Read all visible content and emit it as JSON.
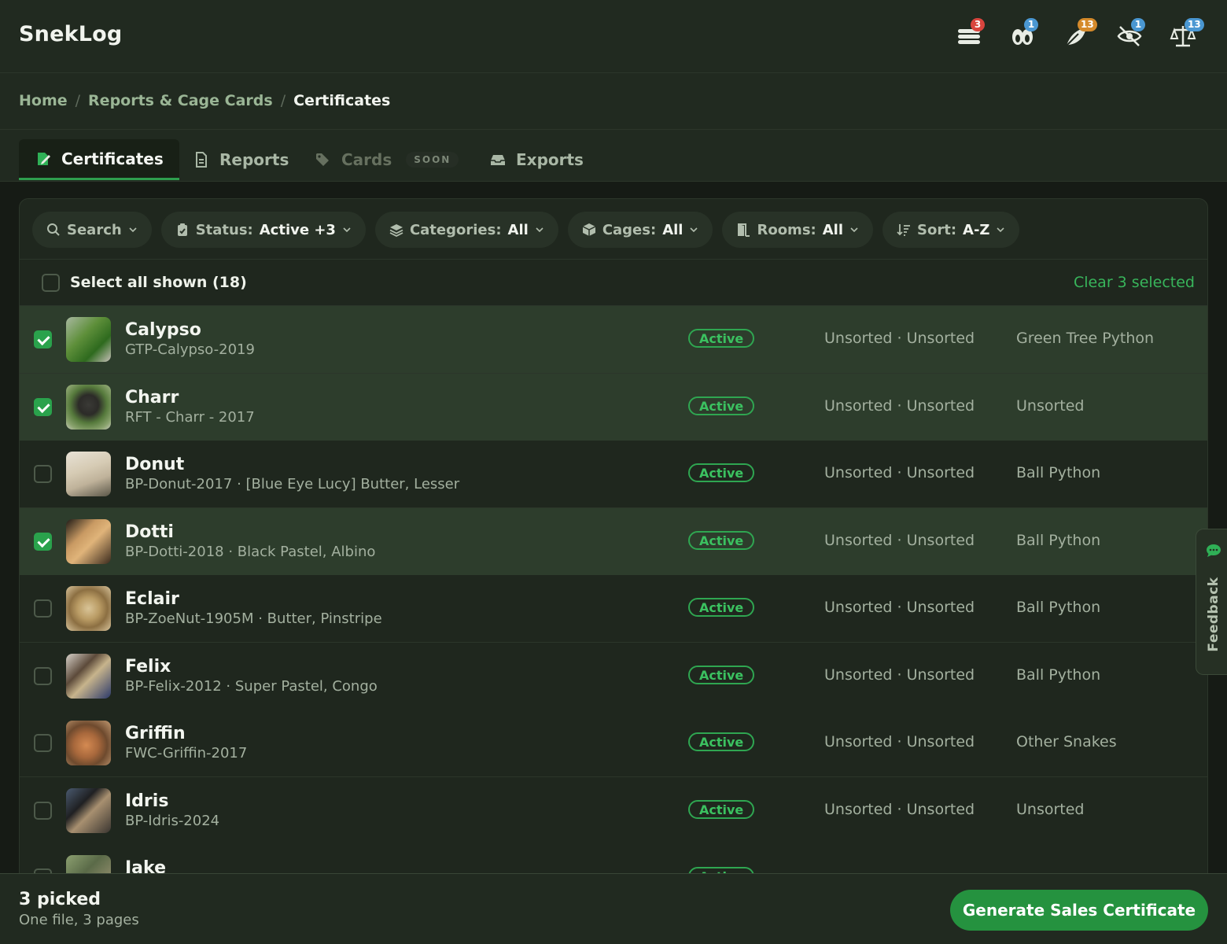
{
  "app": {
    "title": "SnekLog"
  },
  "header_icons": [
    {
      "name": "feeding-stack-icon",
      "badge": "3",
      "badge_color": "#d9453e"
    },
    {
      "name": "pairing-icon",
      "badge": "1",
      "badge_color": "#4a97d2"
    },
    {
      "name": "shed-icon",
      "badge": "13",
      "badge_color": "#d58a2b"
    },
    {
      "name": "hidden-icon",
      "badge": "1",
      "badge_color": "#4a97d2"
    },
    {
      "name": "weight-scale-icon",
      "badge": "13",
      "badge_color": "#4a97d2"
    }
  ],
  "breadcrumb": {
    "home": "Home",
    "reports": "Reports & Cage Cards",
    "current": "Certificates",
    "sep": "/"
  },
  "tabs": {
    "certificates": "Certificates",
    "reports": "Reports",
    "cards": "Cards",
    "cards_badge": "SOON",
    "exports": "Exports"
  },
  "filters": {
    "search": "Search",
    "status_label": "Status:",
    "status_value": "Active +3",
    "categories_label": "Categories:",
    "categories_value": "All",
    "cages_label": "Cages:",
    "cages_value": "All",
    "rooms_label": "Rooms:",
    "rooms_value": "All",
    "sort_label": "Sort:",
    "sort_value": "A-Z"
  },
  "select_all": {
    "label": "Select all shown (18)",
    "clear": "Clear 3 selected"
  },
  "rows": [
    {
      "name": "Calypso",
      "sub": "GTP-Calypso-2019",
      "status": "Active",
      "location": "Unsorted · Unsorted",
      "category": "Green Tree Python",
      "checked": true
    },
    {
      "name": "Charr",
      "sub": "RFT - Charr - 2017",
      "status": "Active",
      "location": "Unsorted · Unsorted",
      "category": "Unsorted",
      "checked": true
    },
    {
      "name": "Donut",
      "sub": "BP-Donut-2017 · [Blue Eye Lucy] Butter, Lesser",
      "status": "Active",
      "location": "Unsorted · Unsorted",
      "category": "Ball Python",
      "checked": false
    },
    {
      "name": "Dotti",
      "sub": "BP-Dotti-2018 · Black Pastel, Albino",
      "status": "Active",
      "location": "Unsorted · Unsorted",
      "category": "Ball Python",
      "checked": true
    },
    {
      "name": "Eclair",
      "sub": "BP-ZoeNut-1905M · Butter, Pinstripe",
      "status": "Active",
      "location": "Unsorted · Unsorted",
      "category": "Ball Python",
      "checked": false
    },
    {
      "name": "Felix",
      "sub": "BP-Felix-2012 · Super Pastel, Congo",
      "status": "Active",
      "location": "Unsorted · Unsorted",
      "category": "Ball Python",
      "checked": false
    },
    {
      "name": "Griffin",
      "sub": "FWC-Griffin-2017",
      "status": "Active",
      "location": "Unsorted · Unsorted",
      "category": "Other Snakes",
      "checked": false
    },
    {
      "name": "Idris",
      "sub": "BP-Idris-2024",
      "status": "Active",
      "location": "Unsorted · Unsorted",
      "category": "Unsorted",
      "checked": false
    },
    {
      "name": "Jake",
      "sub": "",
      "status": "Active",
      "location": "",
      "category": "",
      "checked": false
    }
  ],
  "feedback": {
    "label": "Feedback"
  },
  "footer": {
    "picked": "3 picked",
    "pages": "One file, 3 pages",
    "button": "Generate Sales Certificate"
  },
  "colors": {
    "accent": "#2aa24c",
    "background": "#161b15",
    "panel": "#1f271e",
    "selected_row": "#2d3d2c"
  }
}
